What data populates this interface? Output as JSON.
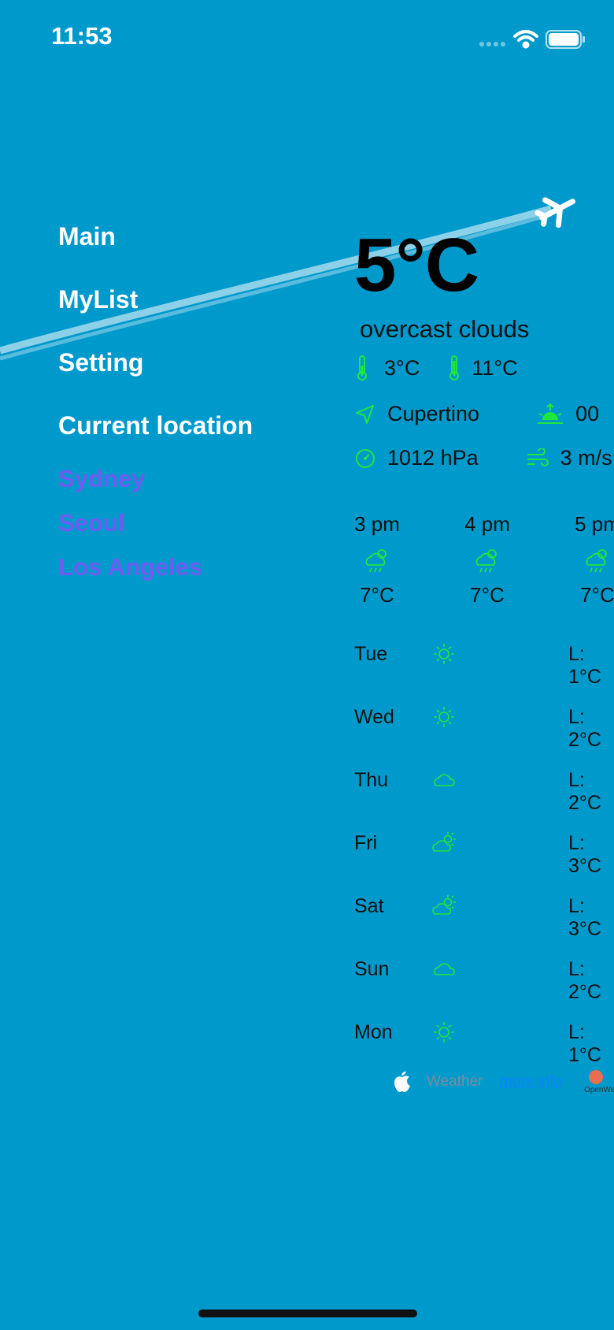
{
  "status_bar": {
    "time": "11:53",
    "icons": [
      "signal-dots-icon",
      "wifi-icon",
      "battery-icon"
    ]
  },
  "menu": {
    "items": [
      {
        "label": "Main"
      },
      {
        "label": "MyList"
      },
      {
        "label": "Setting"
      },
      {
        "label": "Current location"
      }
    ],
    "cities": [
      {
        "label": "Sydney"
      },
      {
        "label": "Seoul"
      },
      {
        "label": "Los Angeles"
      }
    ]
  },
  "current": {
    "temperature": "5°C",
    "description": "overcast clouds",
    "temp_min": "3°C",
    "temp_max": "11°C",
    "location": "Cupertino",
    "sunrise_partial": "00",
    "pressure": "1012 hPa",
    "wind": "3 m/s"
  },
  "hourly": [
    {
      "time": "3 pm",
      "icon": "cloud-sun-rain-icon",
      "temp": "7°C"
    },
    {
      "time": "4 pm",
      "icon": "cloud-sun-rain-icon",
      "temp": "7°C"
    },
    {
      "time": "5 pm",
      "icon": "cloud-sun-rain-icon",
      "temp": "7°C"
    }
  ],
  "daily": [
    {
      "day": "Tue",
      "icon": "sun-icon",
      "low": "L: 1°C"
    },
    {
      "day": "Wed",
      "icon": "sun-icon",
      "low": "L: 2°C"
    },
    {
      "day": "Thu",
      "icon": "cloud-icon",
      "low": "L: 2°C"
    },
    {
      "day": "Fri",
      "icon": "cloud-sun-icon",
      "low": "L: 3°C"
    },
    {
      "day": "Sat",
      "icon": "cloud-sun-icon",
      "low": "L: 3°C"
    },
    {
      "day": "Sun",
      "icon": "cloud-icon",
      "low": "L: 2°C"
    },
    {
      "day": "Mon",
      "icon": "sun-icon",
      "low": "L: 1°C"
    }
  ],
  "footer": {
    "weather_label": "Weather",
    "more_info": "more info",
    "openweather_label": "OpenWe"
  },
  "colors": {
    "background": "#0099CC",
    "icon_green": "#1EE83C",
    "city_purple": "#6E5CF0",
    "link_blue": "#0A84FF"
  }
}
